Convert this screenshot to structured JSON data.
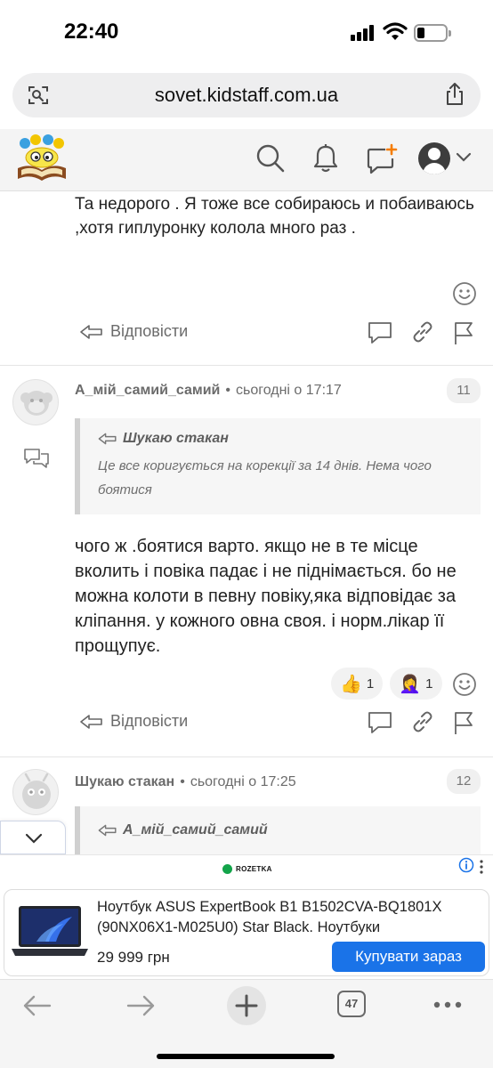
{
  "status_bar": {
    "time": "22:40"
  },
  "browser": {
    "url": "sovet.kidstaff.com.ua",
    "tabs_count": "47"
  },
  "site_header": {
    "icons": [
      "logo-icon",
      "search-icon",
      "bell-icon",
      "new-message-icon",
      "avatar-icon",
      "chevron-down-icon"
    ]
  },
  "posts": {
    "prev": {
      "text": "Та недорого . Я тоже все собираюсь и побаиваюсь ,хотя гиплуронку колола много раз .",
      "reply_label": "Відповісти"
    },
    "p11": {
      "author": "А_мій_самий_самий",
      "time": "сьогодні о 17:17",
      "number": "11",
      "quote_author": "Шукаю стакан",
      "quote_text": "Це все коригується на корекції за 14 днів. Нема чого боятися",
      "text": "чого ж .боятися варто. якщо не в те місце вколить і повіка падає і не піднімається. бо не можна колоти в певну повіку,яка відповідає за кліпання. у кожного овна своя. і норм.лікар її прощупує.",
      "reactions": [
        {
          "emoji": "👍",
          "count": "1"
        },
        {
          "emoji": "🤦‍♀️",
          "count": "1"
        }
      ],
      "reply_label": "Відповісти"
    },
    "p12": {
      "author": "Шукаю стакан",
      "time": "сьогодні о 17:25",
      "number": "12",
      "quote_author": "А_мій_самий_самий"
    }
  },
  "ad": {
    "brand": "ROZETKA",
    "title": "Ноутбук ASUS ExpertBook B1 B1502CVA-BQ1801X (90NX06X1-M025U0) Star Black. Ноутбуки",
    "price": "29 999 грн",
    "cta": "Купувати зараз"
  },
  "colors": {
    "accent": "#1a73e8",
    "notification": "#f57c00",
    "brand_green": "#13a44a"
  }
}
